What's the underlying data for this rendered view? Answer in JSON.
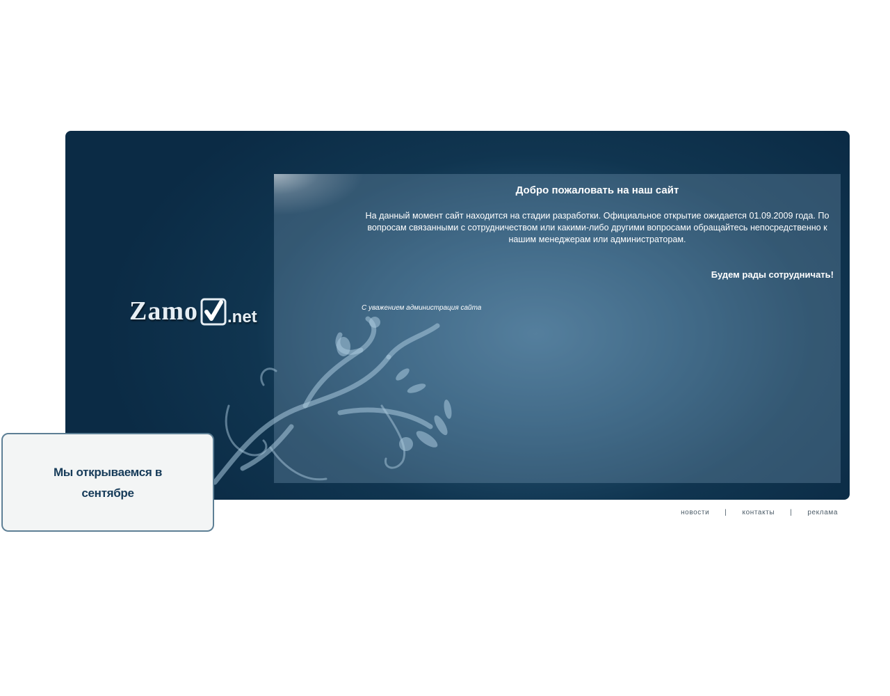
{
  "logo": {
    "main": "Zamo",
    "tld": ".net",
    "check_icon": "checkbox-check-icon"
  },
  "content": {
    "title": "Добро пожаловать на наш сайт",
    "intro": "На данный момент сайт находится на стадии разработки. Официальное открытие ожидается 01.09.2009 года. По вопросам связанными с сотрудничеством или какими-либо другими вопросами обращайтесь непосредственно к нашим менеджерам или администраторам.",
    "cooperate": "Будем рады сотрудничать!",
    "signature": "С уважением администрация сайта"
  },
  "notice": {
    "line1": "Мы открываемся в",
    "line2": "сентябре"
  },
  "footer": {
    "links": [
      "новости",
      "контакты",
      "реклама"
    ],
    "separator": "|"
  },
  "colors": {
    "panel_dark": "#0b2b45",
    "panel_light": "#3f6d8d",
    "notice_border": "#5d7f95",
    "notice_text": "#163b59"
  }
}
